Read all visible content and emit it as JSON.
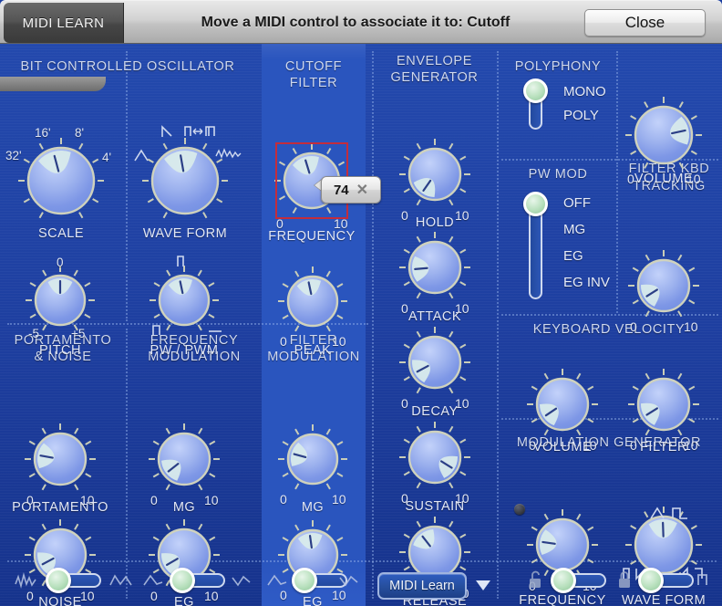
{
  "titlebar": {
    "tab_label": "MIDI LEARN",
    "message": "Move a MIDI control to associate it to: Cutoff",
    "close_label": "Close"
  },
  "badge": {
    "value": "74",
    "close_glyph": "✕"
  },
  "sections": {
    "bco": {
      "title": "BIT CONTROLLED OSCILLATOR"
    },
    "cutoff": {
      "title": "CUTOFF FILTER"
    },
    "envelope": {
      "title_line1": "ENVELOPE",
      "title_line2": "GENERATOR"
    },
    "polyphony": {
      "title": "POLYPHONY"
    },
    "pwmod": {
      "title": "PW MOD"
    },
    "filter_kbd": {
      "title_line1": "FILTER KBD",
      "title_line2": "TRACKING"
    },
    "portamento_noise": {
      "title_line1": "PORTAMENTO",
      "title_line2": "& NOISE"
    },
    "freq_mod": {
      "title_line1": "FREQUENCY",
      "title_line2": "MODULATION"
    },
    "filter_mod": {
      "title_line1": "FILTER",
      "title_line2": "MODULATION"
    },
    "kbd_velocity": {
      "title": "KEYBOARD VELOCITY"
    },
    "mod_gen": {
      "title": "MODULATION GENERATOR"
    }
  },
  "knobs": {
    "scale": {
      "caption": "SCALE",
      "min_label": "32'",
      "max_label": "4'",
      "top_left": "16'",
      "top_right": "8'",
      "angle": -15
    },
    "waveform": {
      "caption": "WAVE FORM",
      "min_label": "",
      "max_label": "",
      "angle": -10
    },
    "pitch": {
      "caption": "PITCH",
      "min_label": "-5",
      "max_label": "+5",
      "top_label": "0",
      "angle": 0
    },
    "pwpwm": {
      "caption": "PW / PWM",
      "min_label": "",
      "max_label": "",
      "angle": -12
    },
    "frequency_cut": {
      "caption": "FREQUENCY",
      "min_label": "0",
      "max_label": "10",
      "angle": -17
    },
    "peak": {
      "caption": "PEAK",
      "min_label": "0",
      "max_label": "10",
      "angle": -12
    },
    "filtmod_mg": {
      "caption": "MG",
      "min_label": "0",
      "max_label": "10",
      "angle": -75
    },
    "filtmod_eg": {
      "caption": "EG",
      "min_label": "0",
      "max_label": "10",
      "angle": -8
    },
    "hold": {
      "caption": "HOLD",
      "min_label": "0",
      "max_label": "10",
      "angle": -145
    },
    "attack": {
      "caption": "ATTACK",
      "min_label": "0",
      "max_label": "10",
      "angle": -95
    },
    "decay": {
      "caption": "DECAY",
      "min_label": "0",
      "max_label": "10",
      "angle": -118
    },
    "sustain": {
      "caption": "SUSTAIN",
      "min_label": "0",
      "max_label": "10",
      "angle": 122
    },
    "release": {
      "caption": "RELEASE",
      "min_label": "0",
      "max_label": "10",
      "angle": -38
    },
    "portamento": {
      "caption": "PORTAMENTO",
      "min_label": "0",
      "max_label": "10",
      "angle": -80
    },
    "noise": {
      "caption": "NOISE",
      "min_label": "0",
      "max_label": "10",
      "angle": -118
    },
    "fm_mg": {
      "caption": "MG",
      "min_label": "0",
      "max_label": "10",
      "angle": -128
    },
    "fm_eg": {
      "caption": "EG",
      "min_label": "0",
      "max_label": "10",
      "angle": -120
    },
    "volume": {
      "caption": "VOLUME",
      "min_label": "0",
      "max_label": "10",
      "angle": 78
    },
    "filter_kbd": {
      "caption": "",
      "min_label": "0",
      "max_label": "10",
      "angle": -122
    },
    "kv_volume": {
      "caption": "VOLUME",
      "min_label": "0",
      "max_label": "10",
      "angle": -124
    },
    "kv_filter": {
      "caption": "FILTER",
      "min_label": "0",
      "max_label": "10",
      "angle": -122
    },
    "mg_frequency": {
      "caption": "FREQUENCY",
      "min_label": "0",
      "max_label": "10",
      "angle": -82
    },
    "mg_waveform": {
      "caption": "WAVE FORM",
      "min_label": "",
      "max_label": "",
      "angle": -2
    }
  },
  "sliders": {
    "polyphony": {
      "options": [
        "MONO",
        "POLY"
      ],
      "selected": "MONO"
    },
    "pwmod": {
      "options": [
        "OFF",
        "MG",
        "EG",
        "EG INV"
      ],
      "selected": "OFF"
    }
  },
  "bottom_bar": {
    "midi_learn_label": "MIDI Learn",
    "slider_noise": {
      "left_icon": "noise-wave-icon",
      "right_icon": "smooth-wave-icon"
    },
    "slider_eg1": {
      "left_icon": "ramp-wave-icon",
      "right_icon": "dip-wave-icon"
    },
    "slider_eg2": {
      "left_icon": "ramp-wave-icon",
      "right_icon": "dip-wave-icon"
    },
    "slider_lock": {
      "left_icon": "unlock-icon",
      "right_icon": "lock-icon"
    },
    "slider_waveform": {
      "left_icon": "triangle-wave-icon",
      "right_icon": "square-wave-icon"
    }
  },
  "colors": {
    "panel_blue": "#1e3fa0",
    "cutoff_highlight": "#2a55be",
    "selection_red": "#c32d3c",
    "knob_light": "#aebff0",
    "slider_green": "#b8e0bd"
  }
}
